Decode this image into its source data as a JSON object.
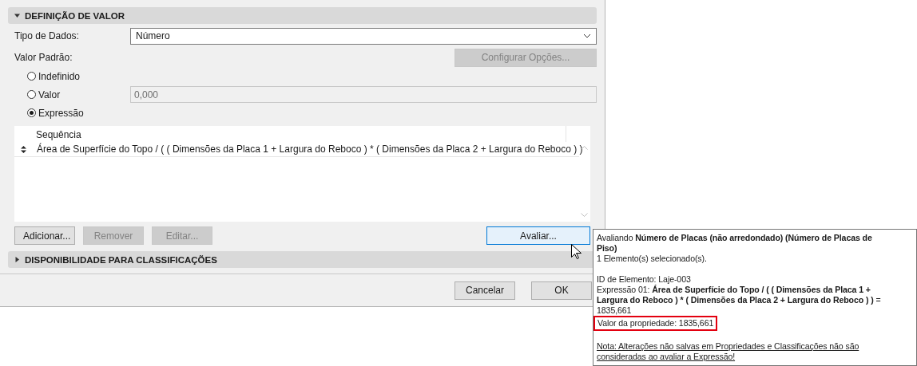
{
  "value_section": {
    "title": "DEFINIÇÃO DE VALOR",
    "expanded": true
  },
  "data_type": {
    "label": "Tipo de Dados:",
    "value": "Número"
  },
  "default_value": {
    "label": "Valor Padrão:",
    "options_button": {
      "label": "Configurar Opções...",
      "disabled": true
    }
  },
  "radios": [
    {
      "label": "Indefinido",
      "selected": false
    },
    {
      "label": "Valor",
      "selected": false
    },
    {
      "label": "Expressão",
      "selected": true
    }
  ],
  "value_field": {
    "value": "0,000",
    "disabled": true
  },
  "table": {
    "columns": [
      "Sequência"
    ],
    "rows": [
      {
        "expression": "Área de Superfície do Topo / ( ( Dimensões da Placa 1 + Largura do Reboco ) * ( Dimensões da Placa 2 + Largura do Reboco ) )"
      }
    ]
  },
  "buttons": [
    {
      "label": "Adicionar...",
      "disabled": false
    },
    {
      "label": "Remover",
      "disabled": true
    },
    {
      "label": "Editar...",
      "disabled": true
    }
  ],
  "evaluate_button": {
    "label": "Avaliar..."
  },
  "classification_section": {
    "title": "DISPONIBILIDADE PARA CLASSIFICAÇÕES",
    "expanded": false
  },
  "dialog_buttons": [
    "Cancelar",
    "OK"
  ],
  "tooltip": {
    "paragraphs": [
      [
        {
          "kind": "text",
          "text": "Avaliando **Número de Placas (não arredondado) (Número de Placas de Piso)**"
        },
        {
          "kind": "text",
          "text": "1 Elemento(s) selecionado(s)."
        }
      ],
      [
        {
          "kind": "text",
          "text": "ID de Elemento: Laje-003"
        },
        {
          "kind": "text",
          "text": "Expressão 01: **Área de Superfície do Topo / ( ( Dimensões da Placa 1 + Largura do Reboco ) * ( Dimensões da Placa 2 + Largura do Reboco ) )** = 1835,661"
        },
        {
          "kind": "highlight",
          "text": "Valor da propriedade: 1835,661"
        }
      ],
      [
        {
          "kind": "note",
          "text": "Nota: Alterações não salvas em Propriedades e Classificações não são consideradas ao avaliar a Expressão!"
        }
      ]
    ]
  }
}
